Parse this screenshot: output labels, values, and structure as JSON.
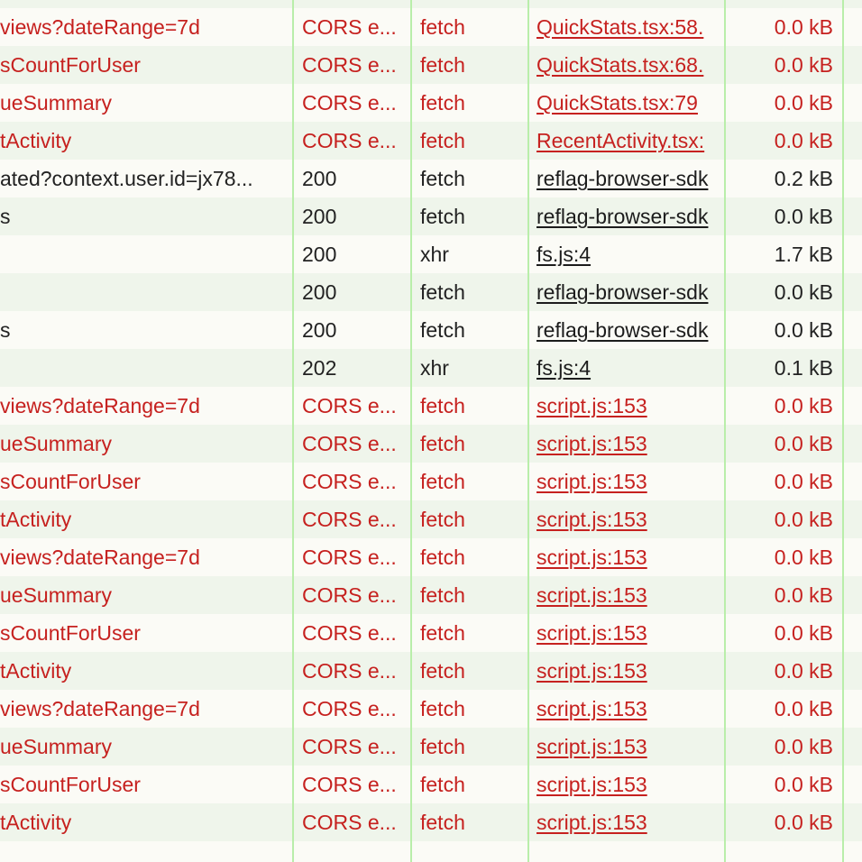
{
  "colors": {
    "error_text": "#c6211f",
    "normal_text": "#222222",
    "row_alt_bg": "#eff5eb",
    "row_bg": "#fbfbf6",
    "column_divider": "#b9eeaa"
  },
  "rows": [
    {
      "name": "views?dateRange=7d",
      "status": "CORS e...",
      "type": "fetch",
      "initiator": "QuickStats.tsx:58.",
      "size": "0.0 kB",
      "error": true
    },
    {
      "name": "sCountForUser",
      "status": "CORS e...",
      "type": "fetch",
      "initiator": "QuickStats.tsx:68.",
      "size": "0.0 kB",
      "error": true
    },
    {
      "name": "ueSummary",
      "status": "CORS e...",
      "type": "fetch",
      "initiator": "QuickStats.tsx:79",
      "size": "0.0 kB",
      "error": true
    },
    {
      "name": "tActivity",
      "status": "CORS e...",
      "type": "fetch",
      "initiator": "RecentActivity.tsx:",
      "size": "0.0 kB",
      "error": true
    },
    {
      "name": "ated?context.user.id=jx78...",
      "status": "200",
      "type": "fetch",
      "initiator": "reflag-browser-sdk",
      "size": "0.2 kB",
      "error": false
    },
    {
      "name": "s",
      "status": "200",
      "type": "fetch",
      "initiator": "reflag-browser-sdk",
      "size": "0.0 kB",
      "error": false
    },
    {
      "name": "",
      "status": "200",
      "type": "xhr",
      "initiator": "fs.js:4",
      "size": "1.7 kB",
      "error": false
    },
    {
      "name": "",
      "status": "200",
      "type": "fetch",
      "initiator": "reflag-browser-sdk",
      "size": "0.0 kB",
      "error": false
    },
    {
      "name": "s",
      "status": "200",
      "type": "fetch",
      "initiator": "reflag-browser-sdk",
      "size": "0.0 kB",
      "error": false
    },
    {
      "name": "",
      "status": "202",
      "type": "xhr",
      "initiator": "fs.js:4",
      "size": "0.1 kB",
      "error": false
    },
    {
      "name": "views?dateRange=7d",
      "status": "CORS e...",
      "type": "fetch",
      "initiator": "script.js:153",
      "size": "0.0 kB",
      "error": true
    },
    {
      "name": "ueSummary",
      "status": "CORS e...",
      "type": "fetch",
      "initiator": "script.js:153",
      "size": "0.0 kB",
      "error": true
    },
    {
      "name": "sCountForUser",
      "status": "CORS e...",
      "type": "fetch",
      "initiator": "script.js:153",
      "size": "0.0 kB",
      "error": true
    },
    {
      "name": "tActivity",
      "status": "CORS e...",
      "type": "fetch",
      "initiator": "script.js:153",
      "size": "0.0 kB",
      "error": true
    },
    {
      "name": "views?dateRange=7d",
      "status": "CORS e...",
      "type": "fetch",
      "initiator": "script.js:153",
      "size": "0.0 kB",
      "error": true
    },
    {
      "name": "ueSummary",
      "status": "CORS e...",
      "type": "fetch",
      "initiator": "script.js:153",
      "size": "0.0 kB",
      "error": true
    },
    {
      "name": "sCountForUser",
      "status": "CORS e...",
      "type": "fetch",
      "initiator": "script.js:153",
      "size": "0.0 kB",
      "error": true
    },
    {
      "name": "tActivity",
      "status": "CORS e...",
      "type": "fetch",
      "initiator": "script.js:153",
      "size": "0.0 kB",
      "error": true
    },
    {
      "name": "views?dateRange=7d",
      "status": "CORS e...",
      "type": "fetch",
      "initiator": "script.js:153",
      "size": "0.0 kB",
      "error": true
    },
    {
      "name": "ueSummary",
      "status": "CORS e...",
      "type": "fetch",
      "initiator": "script.js:153",
      "size": "0.0 kB",
      "error": true
    },
    {
      "name": "sCountForUser",
      "status": "CORS e...",
      "type": "fetch",
      "initiator": "script.js:153",
      "size": "0.0 kB",
      "error": true
    },
    {
      "name": "tActivity",
      "status": "CORS e...",
      "type": "fetch",
      "initiator": "script.js:153",
      "size": "0.0 kB",
      "error": true
    }
  ]
}
